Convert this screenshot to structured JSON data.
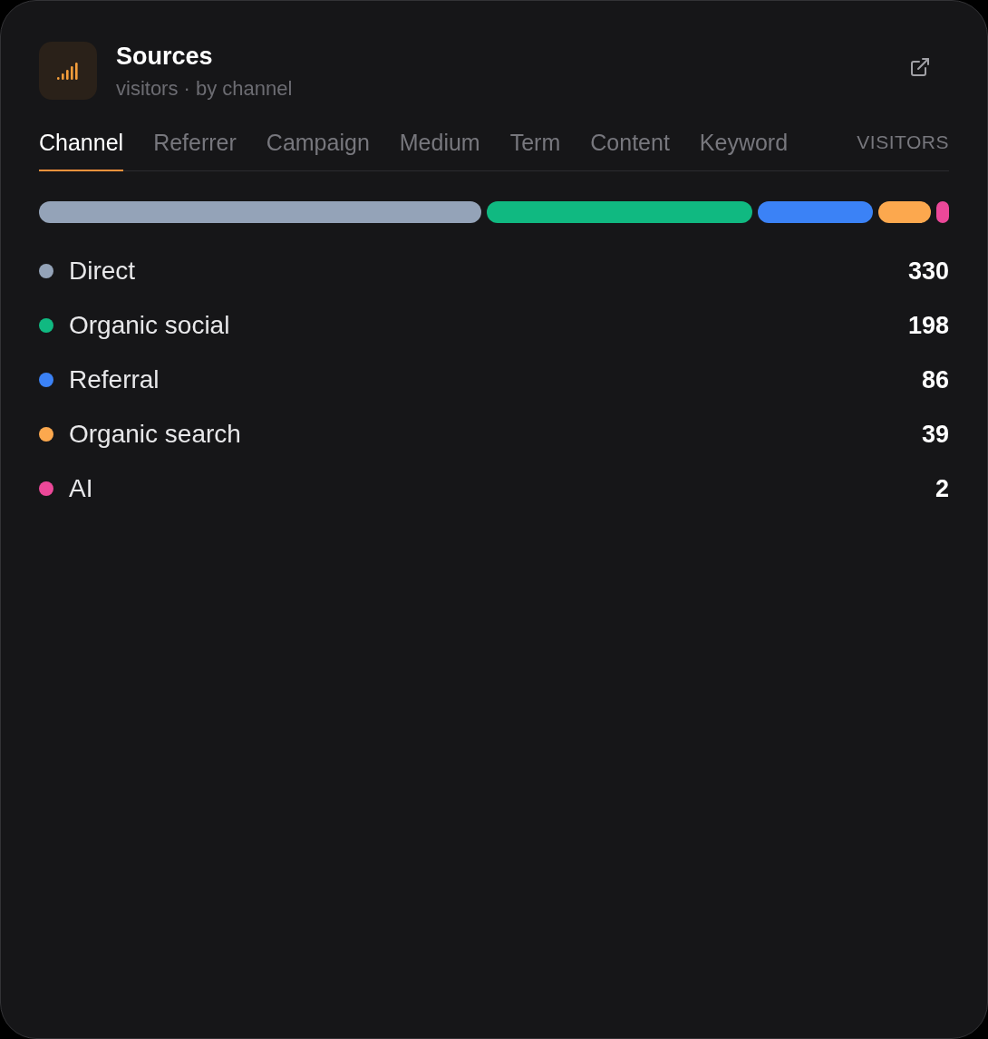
{
  "panel": {
    "title": "Sources",
    "subtitle": "visitors · by channel"
  },
  "tabs": [
    {
      "label": "Channel",
      "selected": true
    },
    {
      "label": "Referrer",
      "selected": false
    },
    {
      "label": "Campaign",
      "selected": false
    },
    {
      "label": "Medium",
      "selected": false
    },
    {
      "label": "Term",
      "selected": false
    },
    {
      "label": "Content",
      "selected": false
    },
    {
      "label": "Keyword",
      "selected": false
    }
  ],
  "column_header": "VISITORS",
  "channels": [
    {
      "name": "Direct",
      "value": "330",
      "color": "#94a3b8"
    },
    {
      "name": "Organic social",
      "value": "198",
      "color": "#10b981"
    },
    {
      "name": "Referral",
      "value": "86",
      "color": "#3b82f6"
    },
    {
      "name": "Organic search",
      "value": "39",
      "color": "#fca84e"
    },
    {
      "name": "AI",
      "value": "2",
      "color": "#ec4899"
    }
  ]
}
